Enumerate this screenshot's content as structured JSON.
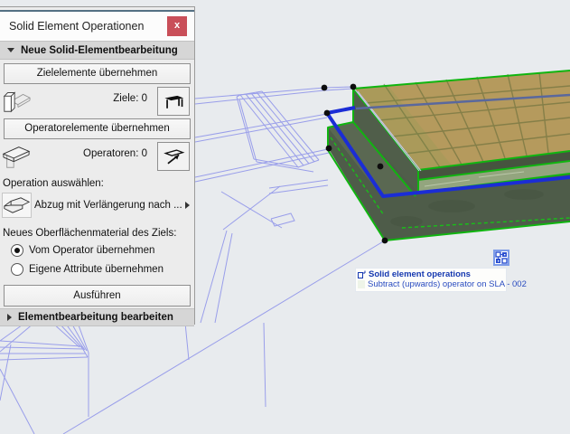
{
  "window": {
    "title": "Solid Element Operationen",
    "close_label": "x"
  },
  "sections": {
    "new_operation": {
      "label": "Neue Solid-Elementbearbeitung"
    },
    "edit_operation": {
      "label": "Elementbearbeitung bearbeiten"
    }
  },
  "targets": {
    "button": "Zielelemente übernehmen",
    "count_label": "Ziele: 0"
  },
  "operators": {
    "button": "Operatorelemente übernehmen",
    "count_label": "Operatoren: 0"
  },
  "operation": {
    "label": "Operation auswählen:",
    "selected": "Abzug mit Verlängerung nach ..."
  },
  "material": {
    "label": "Neues Oberflächenmaterial des Ziels:",
    "options": [
      {
        "label": "Vom Operator übernehmen",
        "selected": true
      },
      {
        "label": "Eigene Attribute übernehmen",
        "selected": false
      }
    ]
  },
  "execute_button": "Ausführen",
  "viewport_tag": {
    "line1": "Solid element operations",
    "line2": "Subtract (upwards) operator on SLA - 002"
  },
  "colors": {
    "selection_green": "#10b510",
    "operator_blue": "#1b2dd6",
    "wireframe": "#9196ea",
    "close_red": "#c94f59",
    "tag_blue": "#1d3db8"
  }
}
